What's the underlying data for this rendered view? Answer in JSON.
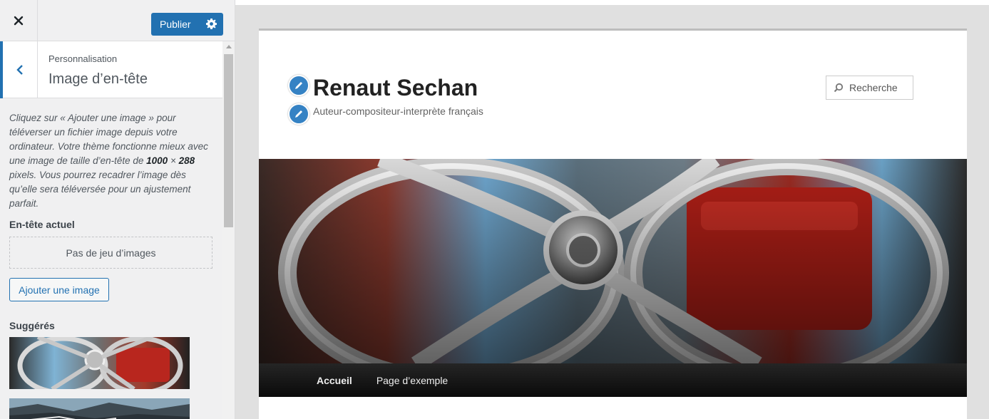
{
  "sidebar": {
    "close_icon": "close-icon",
    "publish_label": "Publier",
    "publish_settings_icon": "gear-icon",
    "back_icon": "chevron-left-icon",
    "breadcrumb": "Personnalisation",
    "section_title": "Image d’en-tête",
    "description_part1": "Cliquez sur « Ajouter une image » pour téléverser un fichier image depuis votre ordinateur. Votre thème fonctionne mieux avec une image de taille d’en-tête de ",
    "description_width": "1000",
    "description_times": " × ",
    "description_height": "288",
    "description_part2": " pixels. Vous pourrez recadrer l’image dès qu’elle sera téléversée pour un ajustement parfait.",
    "current_header_label": "En-tête actuel",
    "no_image_text": "Pas de jeu d’images",
    "add_image_label": "Ajouter une image",
    "suggested_label": "Suggérés"
  },
  "preview": {
    "site_title": "Renaut Sechan",
    "site_description": "Auteur-compositeur-interprète français",
    "edit_icon": "pencil-icon",
    "search_placeholder": "Recherche",
    "search_icon": "search-icon",
    "nav_items": [
      "Accueil",
      "Page d’exemple"
    ]
  },
  "colors": {
    "accent": "#2271b1",
    "edit_pin": "#3582c4",
    "navbar": "#1a1a1a"
  }
}
